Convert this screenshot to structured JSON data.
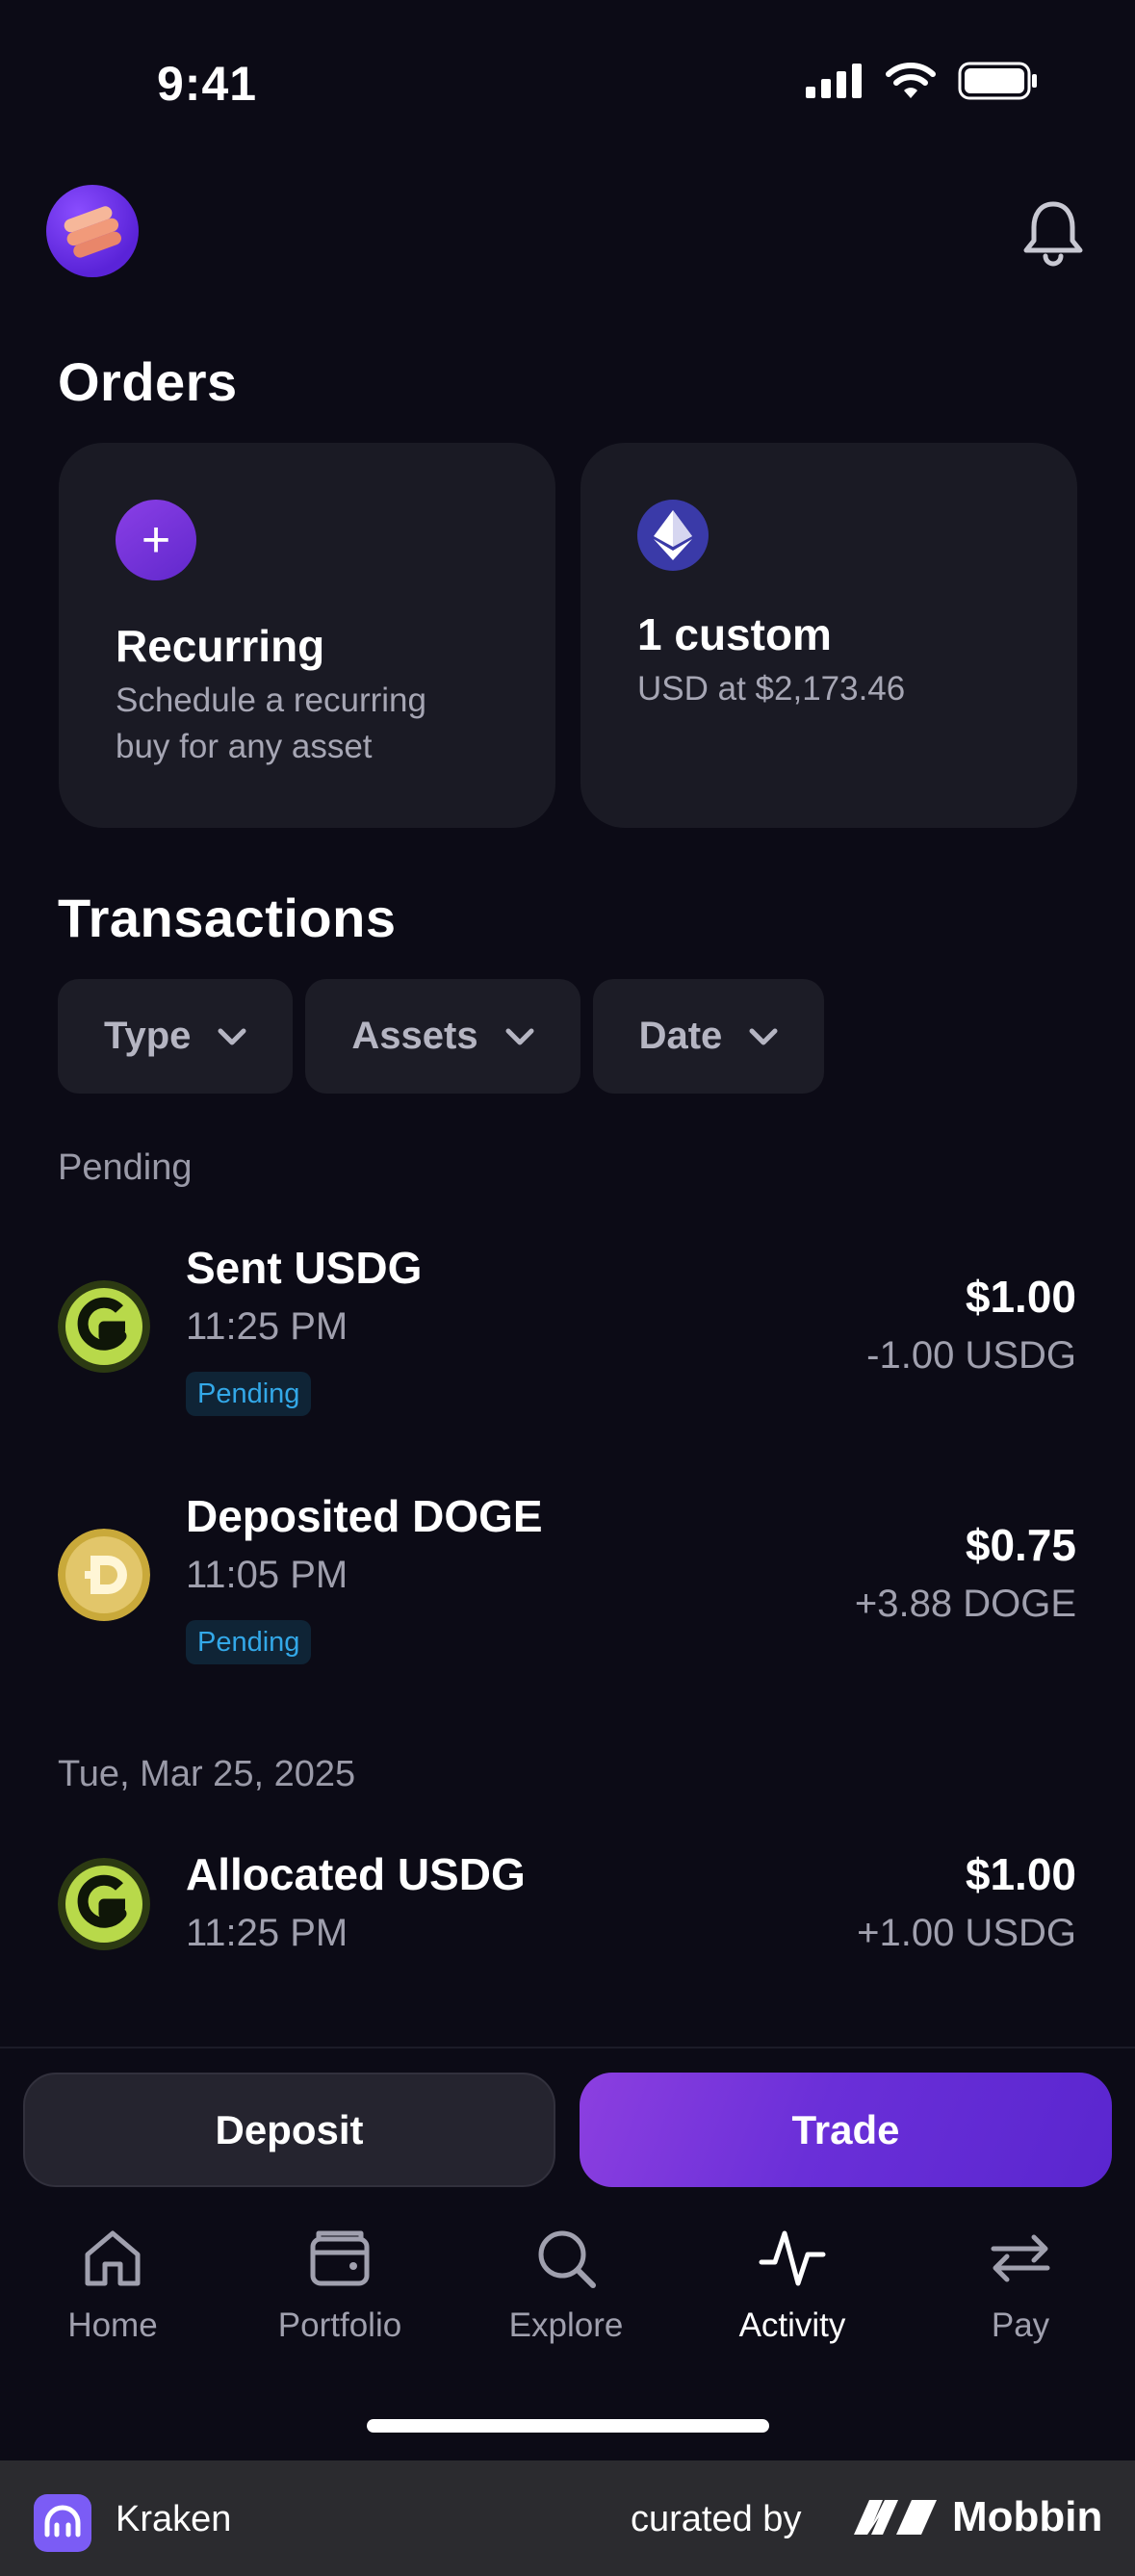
{
  "status_bar": {
    "time": "9:41"
  },
  "header": {
    "avatar_icon": "stacked-coins-icon",
    "bell_icon": "bell-icon"
  },
  "orders": {
    "title": "Orders",
    "cards": [
      {
        "icon": "plus-icon",
        "title": "Recurring",
        "subtitle_line1": "Schedule a recurring",
        "subtitle_line2": "buy for any asset"
      },
      {
        "icon": "ethereum-icon",
        "title": "1 custom",
        "subtitle_line1": "USD at $2,173.46"
      }
    ]
  },
  "transactions": {
    "title": "Transactions",
    "filters": [
      {
        "label": "Type"
      },
      {
        "label": "Assets"
      },
      {
        "label": "Date"
      }
    ],
    "groups": [
      {
        "label": "Pending",
        "items": [
          {
            "icon": "usdg-icon",
            "title": "Sent USDG",
            "time": "11:25 PM",
            "badge": "Pending",
            "amount": "$1.00",
            "sub": "-1.00 USDG"
          },
          {
            "icon": "doge-icon",
            "title": "Deposited DOGE",
            "time": "11:05 PM",
            "badge": "Pending",
            "amount": "$0.75",
            "sub": "+3.88 DOGE"
          }
        ]
      },
      {
        "label": "Tue, Mar 25, 2025",
        "items": [
          {
            "icon": "usdg-icon",
            "title": "Allocated USDG",
            "time": "11:25 PM",
            "amount": "$1.00",
            "sub": "+1.00 USDG"
          }
        ]
      }
    ]
  },
  "actions": {
    "deposit": "Deposit",
    "trade": "Trade"
  },
  "tabs": [
    {
      "label": "Home",
      "icon": "home-icon"
    },
    {
      "label": "Portfolio",
      "icon": "wallet-icon"
    },
    {
      "label": "Explore",
      "icon": "search-icon"
    },
    {
      "label": "Activity",
      "icon": "activity-icon",
      "active": true
    },
    {
      "label": "Pay",
      "icon": "transfer-arrows-icon"
    }
  ],
  "footer": {
    "app_name": "Kraken",
    "curated_by": "curated by",
    "brand": "Mobbin"
  },
  "colors": {
    "background": "#0c0b16",
    "card": "#1a1a24",
    "accent": "#6a2fd8",
    "pending_badge_text": "#33a8e8",
    "usdg_green": "#b8d94a"
  }
}
